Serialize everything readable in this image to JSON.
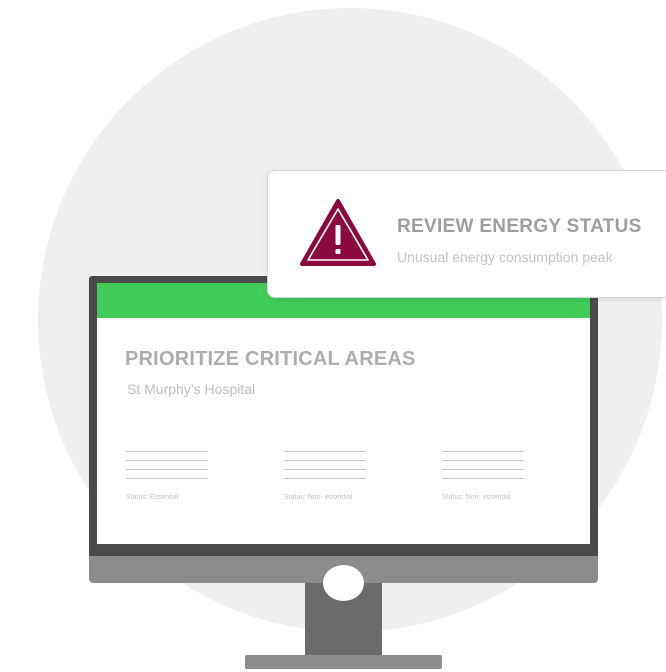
{
  "alert": {
    "title": "REVIEW ENERGY STATUS",
    "message": "Unusual energy consumption peak",
    "icon": "warning-icon",
    "icon_color": "#8b0a3d"
  },
  "screen": {
    "accent_color": "#3fcc59",
    "title": "PRIORITIZE CRITICAL AREAS",
    "subtitle": "St Murphy’s Hospital",
    "areas": [
      {
        "status": "Status: Essential"
      },
      {
        "status": "Status: Non- essential"
      },
      {
        "status": "Status: Non- essential"
      }
    ]
  }
}
